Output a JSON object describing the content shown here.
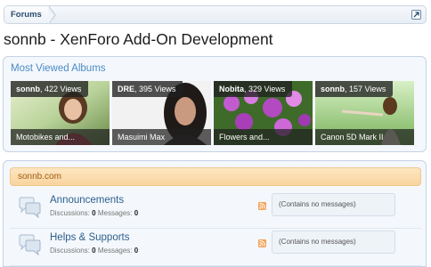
{
  "breadcrumb": {
    "forums_label": "Forums"
  },
  "page": {
    "title": "sonnb - XenForo Add-On Development"
  },
  "albums": {
    "heading": "Most Viewed Albums",
    "items": [
      {
        "owner": "sonnb",
        "views": ", 422 Views",
        "caption": "Motobikes and..."
      },
      {
        "owner": "DRE",
        "views": ", 395 Views",
        "caption": "Masuimi Max"
      },
      {
        "owner": "Nobita",
        "views": ", 329 Views",
        "caption": "Flowers and..."
      },
      {
        "owner": "sonnb",
        "views": ", 157 Views",
        "caption": "Canon 5D Mark II"
      }
    ]
  },
  "forum": {
    "category": "sonnb.com",
    "nodes": [
      {
        "title": "Announcements",
        "discussions_label": "Discussions:",
        "discussions": "0",
        "messages_label": "Messages:",
        "messages": "0",
        "last_post": "(Contains no messages)"
      },
      {
        "title": "Helps & Supports",
        "discussions_label": "Discussions:",
        "discussions": "0",
        "messages_label": "Messages:",
        "messages": "0",
        "last_post": "(Contains no messages)"
      }
    ]
  },
  "colors": {
    "link": "#2d5f8e",
    "heading_blue": "#4a8cc8",
    "category_text": "#a15a12",
    "category_bg": "#f8d49d"
  },
  "icons": [
    "jump-to-icon",
    "forum-node-icon",
    "rss-feed-icon"
  ]
}
